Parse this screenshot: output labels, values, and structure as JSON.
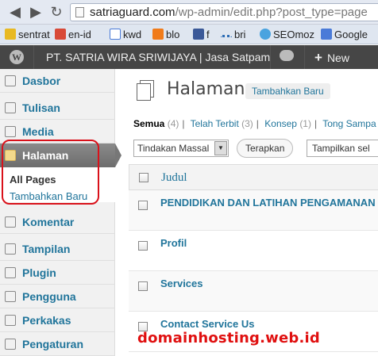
{
  "browser": {
    "url_host": "satriaguard.com",
    "url_path": "/wp-admin/edit.php?post_type=page",
    "back_glyph": "◀",
    "forward_glyph": "▶",
    "reload_glyph": "↻"
  },
  "bookmarks": [
    {
      "label": "sentrat",
      "icon": "folder-icon",
      "color": "#e8b923"
    },
    {
      "label": "en-id",
      "icon": "translate-icon",
      "color": "#d84a38"
    },
    {
      "label": "kwd",
      "icon": "google-g-icon",
      "color": "#4a7bd8"
    },
    {
      "label": "blo",
      "icon": "blogger-icon",
      "color": "#f07b1a"
    },
    {
      "label": "f",
      "icon": "facebook-icon",
      "color": "#3b5998"
    },
    {
      "label": "bri",
      "icon": "dots-icon",
      "color": "#2d6db5"
    },
    {
      "label": "SEOmoz",
      "icon": "seomoz-icon",
      "color": "#4aa3df"
    },
    {
      "label": "Google",
      "icon": "google-icon",
      "color": "#4a7bd8"
    }
  ],
  "adminbar": {
    "logo": "W",
    "site_name": "PT. SATRIA WIRA SRIWIJAYA | Jasa Satpam",
    "new_label": "New",
    "new_plus": "+"
  },
  "sidebar": {
    "items": [
      {
        "label": "Dasbor",
        "icon": "dashboard-icon"
      },
      {
        "label": "Tulisan",
        "icon": "pin-icon"
      },
      {
        "label": "Media",
        "icon": "media-icon"
      },
      {
        "label": "Halaman",
        "icon": "pages-icon",
        "active": true
      },
      {
        "label": "Komentar",
        "icon": "comment-icon"
      },
      {
        "label": "Tampilan",
        "icon": "appearance-icon"
      },
      {
        "label": "Plugin",
        "icon": "plugin-icon"
      },
      {
        "label": "Pengguna",
        "icon": "users-icon"
      },
      {
        "label": "Perkakas",
        "icon": "tools-icon"
      },
      {
        "label": "Pengaturan",
        "icon": "settings-icon"
      }
    ],
    "submenu": {
      "all_pages": "All Pages",
      "add_new": "Tambahkan Baru"
    }
  },
  "main": {
    "title": "Halaman",
    "add_new": "Tambahkan Baru",
    "filters": [
      {
        "label": "Semua",
        "count": "(4)",
        "current": true
      },
      {
        "label": "Telah Terbit",
        "count": "(3)"
      },
      {
        "label": "Konsep",
        "count": "(1)"
      },
      {
        "label": "Tong Sampa",
        "count": ""
      }
    ],
    "bulk_action": "Tindakan Massal",
    "apply": "Terapkan",
    "view_filter": "Tampilkan sel",
    "table": {
      "column_title": "Judul",
      "rows": [
        {
          "title": "PENDIDIKAN DAN LATIHAN PENGAMANAN ("
        },
        {
          "title": "Profil"
        },
        {
          "title": "Services"
        },
        {
          "title": "Contact Service Us"
        }
      ]
    }
  },
  "watermark": "domainhosting.web.id"
}
